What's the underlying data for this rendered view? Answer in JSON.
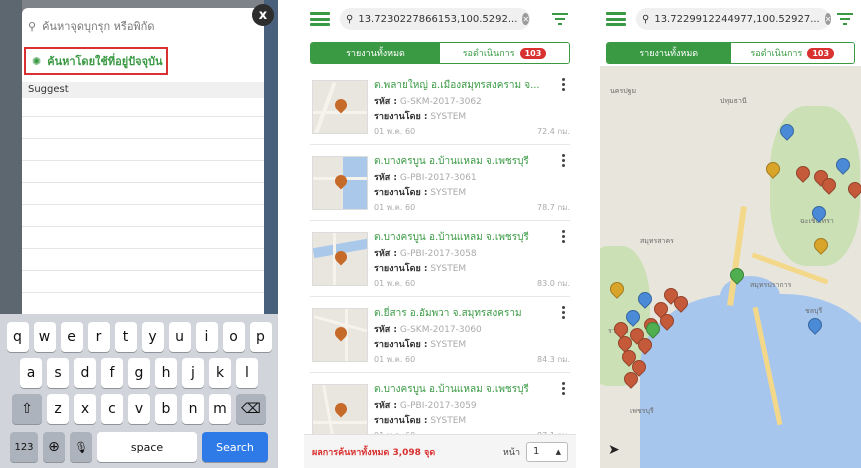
{
  "panel1": {
    "search_placeholder": "ค้นหาจุดบุกรุก หรือพิกัด",
    "close_label": "x",
    "location_button_label": "ค้นหาโดยใช้ที่อยู่ปัจจุบัน",
    "suggest_label": "Suggest",
    "keyboard": {
      "row1": [
        "q",
        "w",
        "e",
        "r",
        "t",
        "y",
        "u",
        "i",
        "o",
        "p"
      ],
      "row2": [
        "a",
        "s",
        "d",
        "f",
        "g",
        "h",
        "j",
        "k",
        "l"
      ],
      "row3": [
        "z",
        "x",
        "c",
        "v",
        "b",
        "n",
        "m"
      ],
      "shift_glyph": "⇧",
      "backspace_glyph": "⌫",
      "numbers_label": "123",
      "globe_glyph": "⊕",
      "mic_glyph": "🎙",
      "space_label": "space",
      "search_label": "Search"
    }
  },
  "panel2": {
    "search_text": "13.7230227866153,100.5292...",
    "tabs": [
      {
        "label": "รายงานทั้งหมด",
        "active": true
      },
      {
        "label": "รอดำเนินการ",
        "active": false,
        "count": "103"
      }
    ],
    "code_label": "รหัส :",
    "reporter_label": "รายงานโดย :",
    "items": [
      {
        "title": "ต.พลายใหญ่ อ.เมืองสมุทรสงคราม จ...",
        "code": "G-SKM-2017-3062",
        "reporter": "SYSTEM",
        "date": "01 พ.ค. 60",
        "distance": "72.4 กม."
      },
      {
        "title": "ต.บางครบูน อ.บ้านแหลม จ.เพชรบุรี",
        "code": "G-PBI-2017-3061",
        "reporter": "SYSTEM",
        "date": "01 พ.ค. 60",
        "distance": "78.7 กม."
      },
      {
        "title": "ต.บางครบูน อ.บ้านแหลม จ.เพชรบุรี",
        "code": "G-PBI-2017-3058",
        "reporter": "SYSTEM",
        "date": "01 พ.ค. 60",
        "distance": "83.0 กม."
      },
      {
        "title": "ต.ยี่สาร อ.อัมพวา จ.สมุทรสงคราม",
        "code": "G-SKM-2017-3060",
        "reporter": "SYSTEM",
        "date": "01 พ.ค. 60",
        "distance": "84.3 กม."
      },
      {
        "title": "ต.บางครบูน อ.บ้านแหลม จ.เพชรบุรี",
        "code": "G-PBI-2017-3059",
        "reporter": "SYSTEM",
        "date": "01 พ.ค. 60",
        "distance": "87.1 กม."
      }
    ],
    "footer": {
      "total": "ผลการค้นหาทั้งหมด 3,098 จุด",
      "page_label": "หน้า",
      "page_value": "1"
    }
  },
  "panel3": {
    "search_text": "13.7229912244977,100.52927...",
    "tabs": [
      {
        "label": "รายงานทั้งหมด",
        "active": true
      },
      {
        "label": "รอดำเนินการ",
        "active": false,
        "count": "103"
      }
    ],
    "map_labels": [
      "นครปฐม",
      "สมุทรสาคร",
      "สมุทรปราการ",
      "ราชบุรี",
      "เพชรบุรี",
      "ฉะเชิงเทรา",
      "ชลบุรี",
      "ปทุมธานี"
    ]
  },
  "colors": {
    "accent_green": "#3a9a44",
    "alert_red": "#d93030",
    "keyboard_search_blue": "#2e7ae6"
  }
}
